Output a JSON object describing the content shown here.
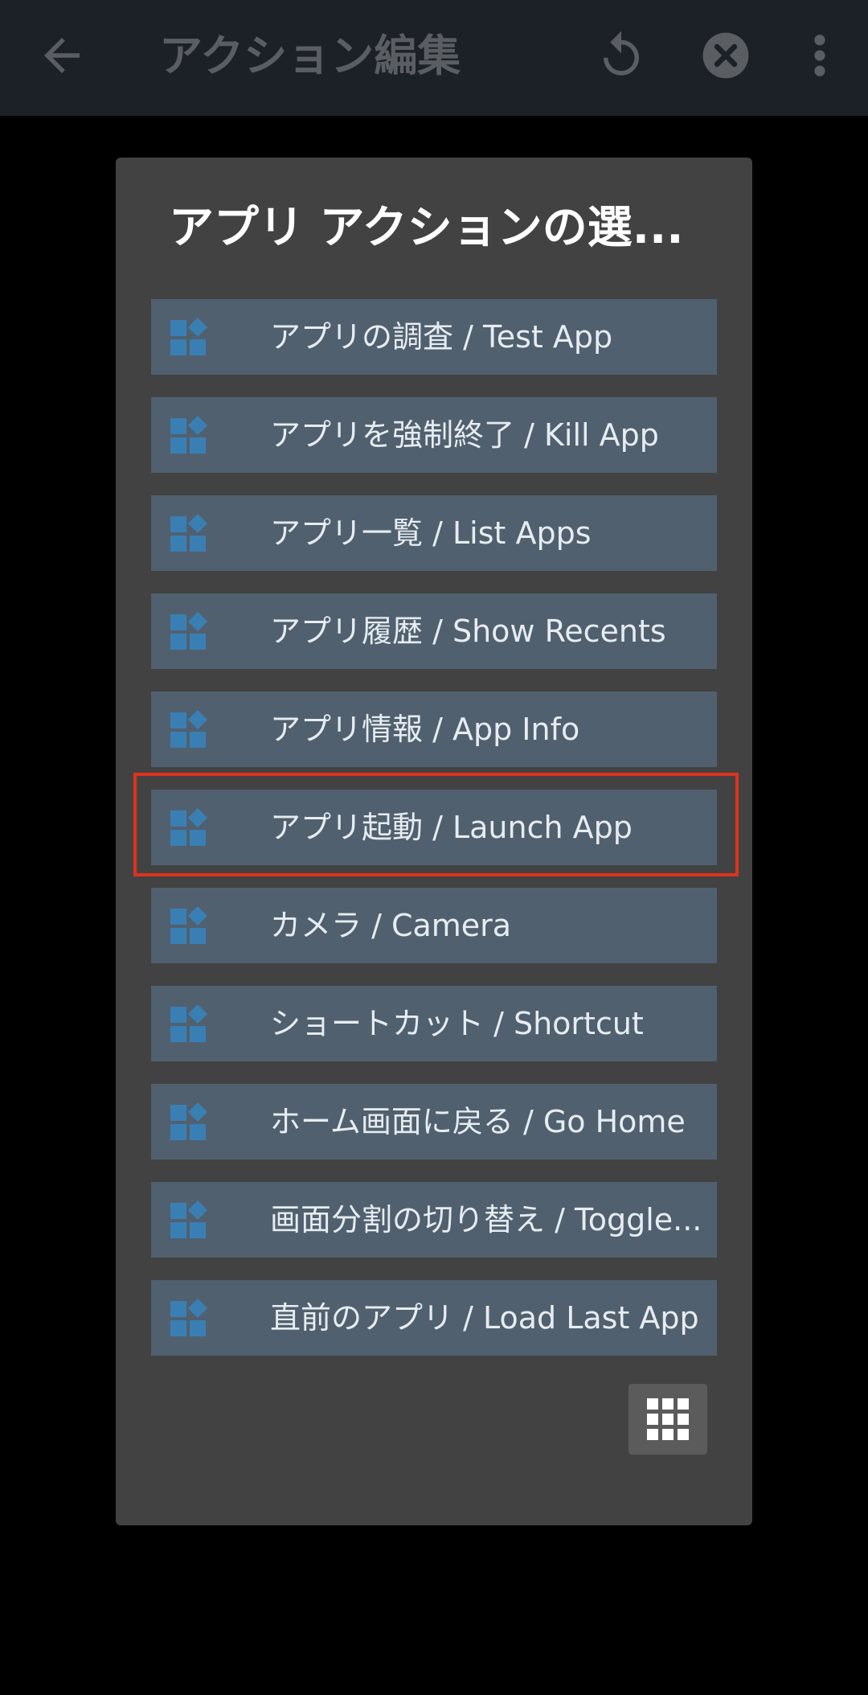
{
  "appbar": {
    "title": "アクション編集",
    "icons": {
      "back": "arrow-back-icon",
      "refresh": "refresh-icon",
      "clear": "clear-icon",
      "more": "more-vert-icon"
    }
  },
  "dialog": {
    "title": "アプリ アクションの選...",
    "items": [
      {
        "label": "アプリの調査 / Test App",
        "icon": "app-category-icon"
      },
      {
        "label": "アプリを強制終了 / Kill App",
        "icon": "app-category-icon"
      },
      {
        "label": "アプリ一覧 / List Apps",
        "icon": "app-category-icon"
      },
      {
        "label": "アプリ履歴 / Show Recents",
        "icon": "app-category-icon"
      },
      {
        "label": "アプリ情報 / App Info",
        "icon": "app-category-icon"
      },
      {
        "label": "アプリ起動 / Launch App",
        "icon": "app-category-icon",
        "highlighted": true
      },
      {
        "label": "カメラ / Camera",
        "icon": "app-category-icon"
      },
      {
        "label": "ショートカット / Shortcut",
        "icon": "app-category-icon"
      },
      {
        "label": "ホーム画面に戻る / Go Home",
        "icon": "app-category-icon"
      },
      {
        "label": "画面分割の切り替え / Toggle...",
        "icon": "app-category-icon"
      },
      {
        "label": "直前のアプリ / Load Last App",
        "icon": "app-category-icon"
      }
    ],
    "grid_button_icon": "grid-view-icon"
  },
  "colors": {
    "appbar_bg": "#1c2128",
    "dialog_bg": "#424242",
    "item_bg": "#50606f",
    "icon_blue": "#3a7fb4",
    "highlight": "#e0321c"
  }
}
